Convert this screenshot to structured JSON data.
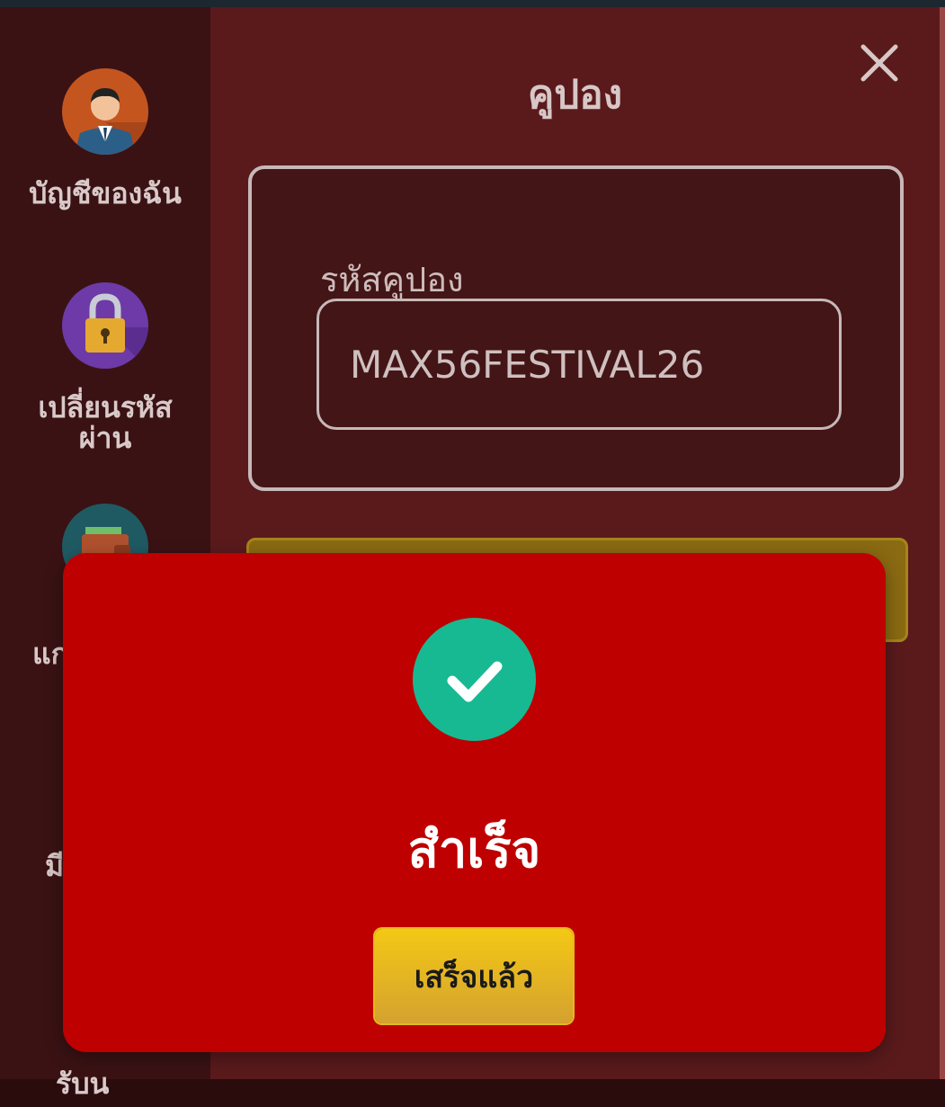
{
  "sidebar": {
    "items": [
      {
        "label": "บัญชีของฉัน",
        "icon": "user-avatar-icon"
      },
      {
        "label": "เปลี่ยนรหัสผ่าน",
        "icon": "padlock-icon"
      },
      {
        "label": "แก",
        "icon": "wallet-icon"
      },
      {
        "label": "มี",
        "icon": "partial-icon"
      },
      {
        "label": "รับน",
        "icon": "partial-icon"
      }
    ]
  },
  "coupon_panel": {
    "title": "คูปอง",
    "field_label": "รหัสคูปอง",
    "field_value": "MAX56FESTIVAL26"
  },
  "success_dialog": {
    "title": "สำเร็จ",
    "done_label": "เสร็จแล้ว"
  },
  "colors": {
    "dialog_bg": "#be0000",
    "check_circle": "#17b992",
    "done_button": "#f4c815",
    "panel_bg": "#5a1a1c",
    "sidebar_bg": "#3a1214"
  }
}
